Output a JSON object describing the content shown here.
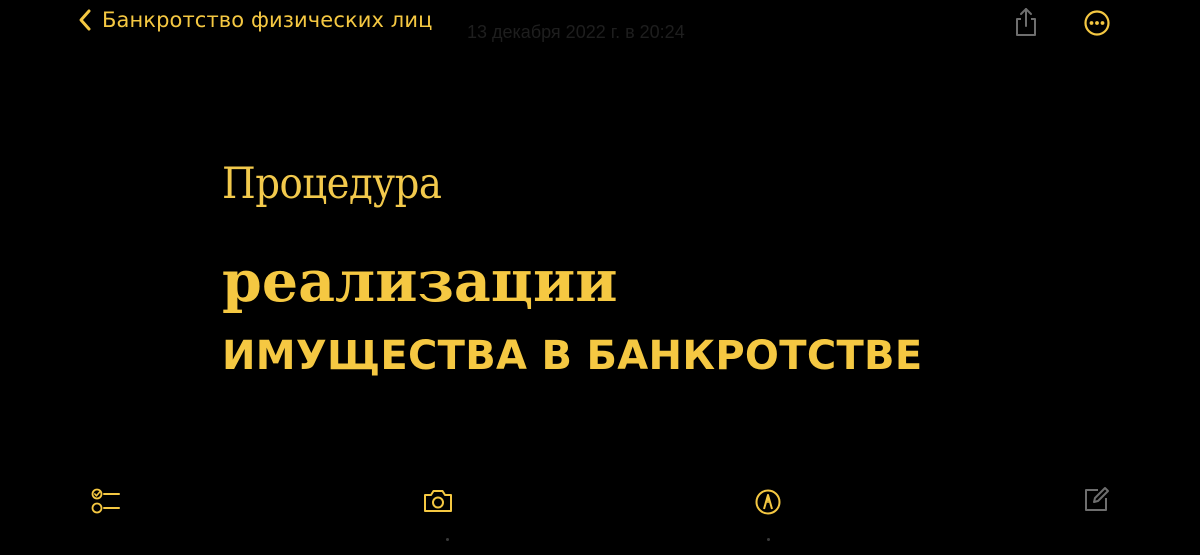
{
  "nav": {
    "back_label": "Банкротство физических лиц",
    "date": "13 декабря 2022 г. в 20:24"
  },
  "note": {
    "line1": "Процедура",
    "line2": "реализации",
    "line3": "ИМУЩЕСТВА В БАНКРОТСТВЕ"
  },
  "colors": {
    "accent": "#f5c842",
    "background": "#000000",
    "inactive_icon": "#6e6e6e"
  },
  "icons": {
    "back": "chevron-left-icon",
    "share": "share-icon",
    "more": "ellipsis-circle-icon",
    "checklist": "checklist-icon",
    "camera": "camera-icon",
    "markup": "markup-pen-icon",
    "compose": "compose-icon"
  }
}
